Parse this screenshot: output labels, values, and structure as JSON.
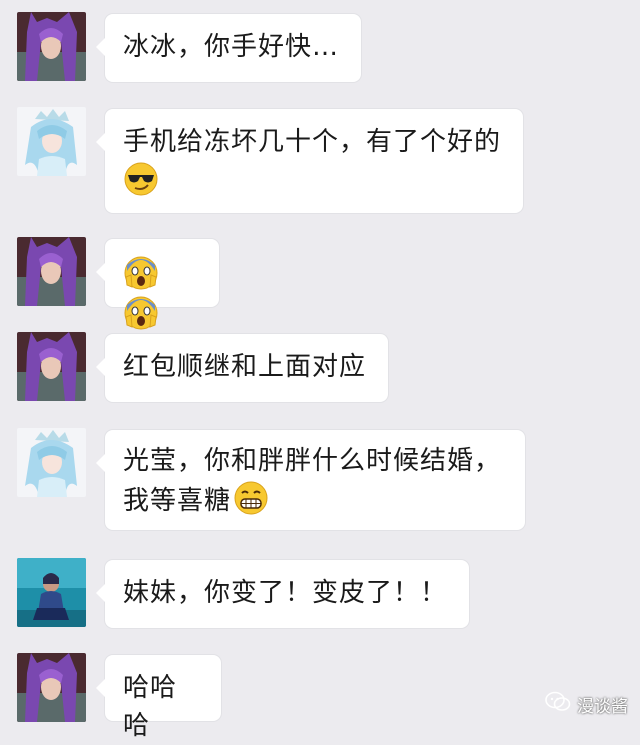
{
  "messages": [
    {
      "text": "冰冰，你手好快…",
      "line2": "",
      "avatar": "purple-hair-avatar"
    },
    {
      "text": "手机给冻坏几十个，有了个好的",
      "line2": "",
      "emojis": [
        "sunglasses-emoji"
      ],
      "avatar": "ice-hair-avatar"
    },
    {
      "text": "",
      "line2": "",
      "emojis": [
        "scream-emoji",
        "scream-emoji"
      ],
      "avatar": "purple-hair-avatar"
    },
    {
      "text": "红包顺继和上面对应",
      "line2": "",
      "avatar": "purple-hair-avatar"
    },
    {
      "text": "光莹，你和胖胖什么时候结婚，",
      "line2": "我等喜糖",
      "emojis": [
        "grimace-emoji"
      ],
      "avatar": "ice-hair-avatar"
    },
    {
      "text": "妹妹，你变了！变皮了！！",
      "line2": "",
      "avatar": "water-scene-avatar"
    },
    {
      "text": "哈哈哈",
      "line2": "",
      "avatar": "purple-hair-avatar"
    }
  ],
  "watermark": {
    "text": "漫谈酱",
    "icon": "wechat-icon"
  },
  "colors": {
    "background": "#ecebef",
    "bubble": "#ffffff",
    "text": "#1a1a1a"
  }
}
